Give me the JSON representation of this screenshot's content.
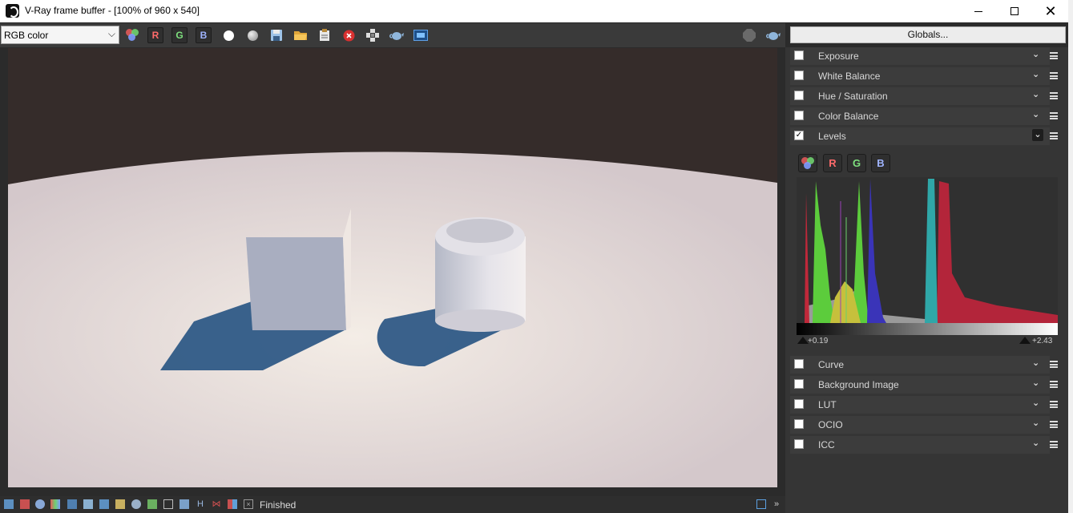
{
  "window": {
    "title": "V-Ray frame buffer - [100% of 960 x 540]",
    "minimize": "minimize",
    "maximize": "maximize",
    "close": "✕"
  },
  "toolbar": {
    "channel_select": "RGB color",
    "red_label": "R",
    "green_label": "G",
    "blue_label": "B",
    "globals_label": "Globals..."
  },
  "panel": {
    "items": [
      {
        "label": "Exposure",
        "checked": false
      },
      {
        "label": "White Balance",
        "checked": false
      },
      {
        "label": "Hue / Saturation",
        "checked": false
      },
      {
        "label": "Color Balance",
        "checked": false
      },
      {
        "label": "Levels",
        "checked": true
      },
      {
        "label": "Curve",
        "checked": false
      },
      {
        "label": "Background Image",
        "checked": false
      },
      {
        "label": "LUT",
        "checked": false
      },
      {
        "label": "OCIO",
        "checked": false
      },
      {
        "label": "ICC",
        "checked": false
      }
    ],
    "levels": {
      "red": "R",
      "green": "G",
      "blue": "B",
      "low_value": "+0.19",
      "high_value": "+2.43"
    }
  },
  "status": {
    "text": "Finished"
  },
  "colors": {
    "bg": "#2b2b2b",
    "panel": "#353535",
    "red": "#e05a5a",
    "green": "#6fd16f",
    "blue": "#7f9cff"
  }
}
